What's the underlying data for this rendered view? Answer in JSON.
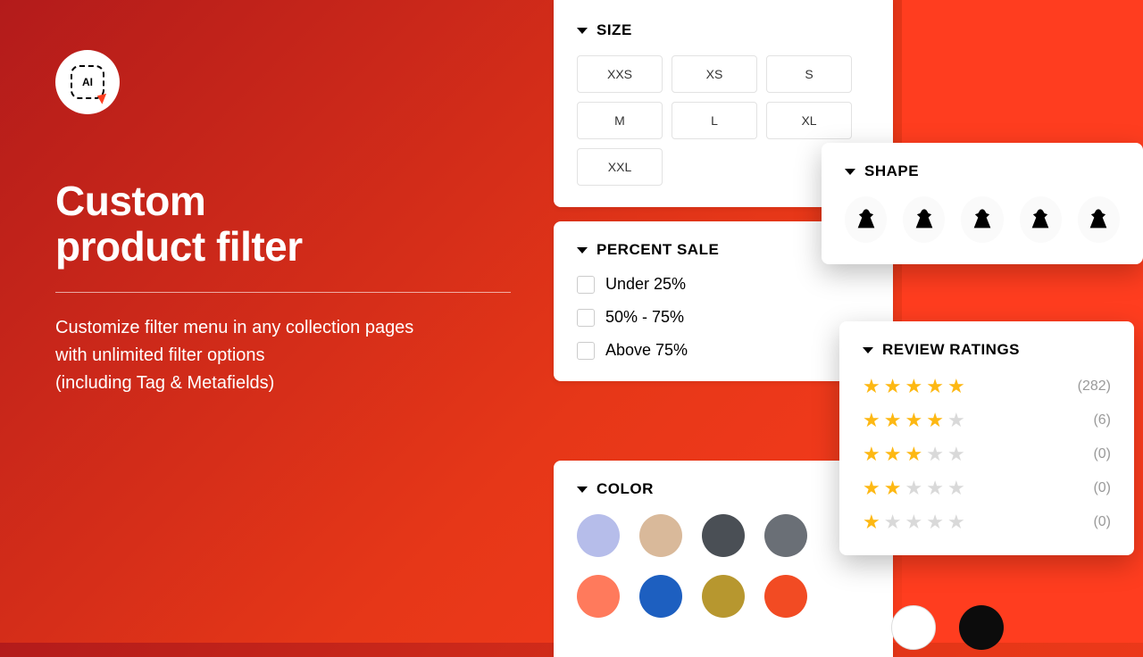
{
  "logo_text": "AI",
  "hero": {
    "title_line1": "Custom",
    "title_line2": "product filter",
    "desc_line1": "Customize filter menu in any collection pages",
    "desc_line2": "with unlimited filter options",
    "desc_line3": "(including Tag & Metafields)"
  },
  "filters": {
    "size": {
      "title": "SIZE",
      "options": [
        "XXS",
        "XS",
        "S",
        "M",
        "L",
        "XL",
        "XXL"
      ]
    },
    "percent_sale": {
      "title": "PERCENT SALE",
      "options": [
        "Under 25%",
        "50% - 75%",
        "Above 75%"
      ]
    },
    "color": {
      "title": "COLOR",
      "row1": [
        "#b6bdea",
        "#d9b99a",
        "#4a4f55",
        "#6a6f76"
      ],
      "row2": [
        "#ff7a5c",
        "#1d5fc0",
        "#b7972f",
        "#f24b23"
      ]
    },
    "shape": {
      "title": "SHAPE",
      "count": 5
    },
    "review": {
      "title": "REVIEW RATINGS",
      "rows": [
        {
          "stars": 5,
          "count": "(282)"
        },
        {
          "stars": 4,
          "count": "(6)"
        },
        {
          "stars": 3,
          "count": "(0)"
        },
        {
          "stars": 2,
          "count": "(0)"
        },
        {
          "stars": 1,
          "count": "(0)"
        }
      ]
    },
    "extra_swatches": [
      "#ffffff",
      "#0c0c0c"
    ]
  }
}
